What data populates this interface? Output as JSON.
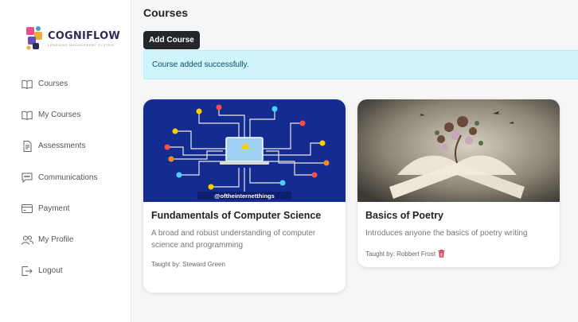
{
  "brand": {
    "name": "COGNIFLOW",
    "tagline": "LEARNING MANAGEMENT SYSTEM"
  },
  "sidebar": {
    "items": [
      {
        "label": "Courses",
        "icon": "book-open-icon"
      },
      {
        "label": "My Courses",
        "icon": "book-open-icon"
      },
      {
        "label": "Assessments",
        "icon": "document-icon"
      },
      {
        "label": "Communications",
        "icon": "chat-icon"
      },
      {
        "label": "Payment",
        "icon": "credit-card-icon"
      },
      {
        "label": "My Profile",
        "icon": "people-icon"
      },
      {
        "label": "Logout",
        "icon": "logout-icon"
      }
    ]
  },
  "header": {
    "title": "Courses",
    "add_button": "Add Course"
  },
  "alert": {
    "message": "Course added successfully."
  },
  "courses": [
    {
      "title": "Fundamentals of Computer Science",
      "description": "A broad and robust understanding of computer science and programming",
      "teacher": "Taught by: Steward Green",
      "image_caption": "@oftheinternetthings"
    },
    {
      "title": "Basics of Poetry",
      "description": "Introduces anyone the basics of poetry writing",
      "teacher": "Taught by: Robbert Frost"
    }
  ],
  "colors": {
    "alert_bg": "#cff4fc",
    "alert_text": "#055160",
    "button_bg": "#23262b",
    "delete_icon": "#dc3545"
  }
}
